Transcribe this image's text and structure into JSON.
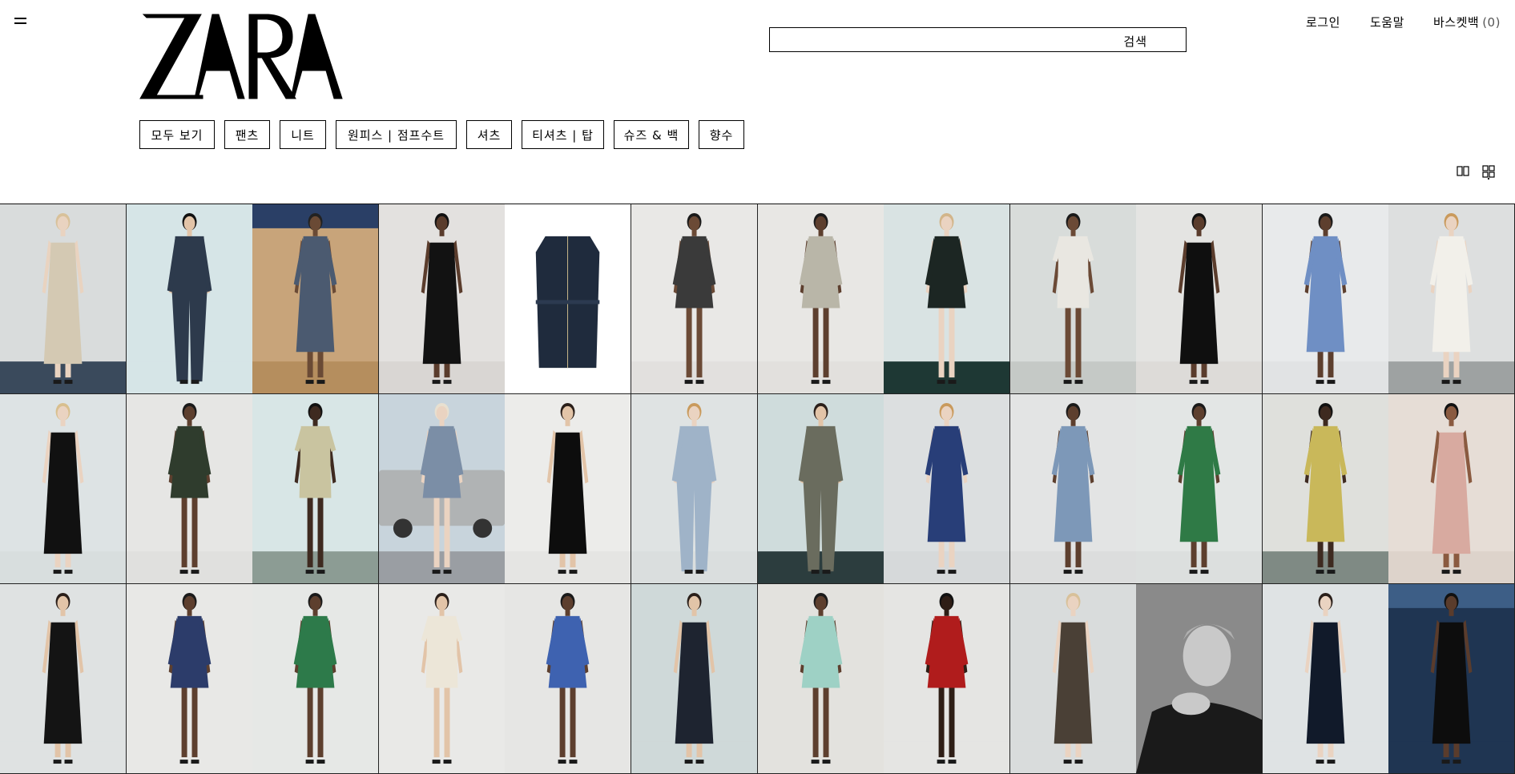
{
  "header": {
    "logo_text": "ZARA",
    "search_label": "검색",
    "links": {
      "login": "로그인",
      "help": "도움말",
      "basket": "바스켓백",
      "basket_count": "(0)"
    }
  },
  "categories": [
    "모두 보기",
    "팬츠",
    "니트",
    "원피스 | 점프수트",
    "셔츠",
    "티셔츠 | 탑",
    "슈즈 & 백",
    "향수"
  ],
  "icons": {
    "menu": "menu-icon",
    "two_column_view": "two-column-grid-icon",
    "four_column_view": "four-column-grid-icon"
  },
  "products": [
    {
      "bg": "#d9dcdc",
      "garment": "#d4c9b3",
      "skin": "#e9d3c0",
      "hair": "#d8c19a",
      "floor": "#3a4a5c",
      "type": "slip"
    },
    {
      "bg": "#d6e5e7",
      "garment": "#2d3a4c",
      "skin": "#e2c4a8",
      "hair": "#111",
      "floor": "#d6e5e7",
      "type": "jumpsuit"
    },
    {
      "bg": "#c8a47a",
      "garment": "#4b5a70",
      "skin": "#6a4a35",
      "hair": "#222",
      "floor": "#b58e5e",
      "type": "dress",
      "sky": "#2a3f66"
    },
    {
      "bg": "#e3e1df",
      "garment": "#121212",
      "skin": "#5a3c2c",
      "hair": "#111",
      "floor": "#d9d6d3",
      "type": "tube"
    },
    {
      "bg": "#ffffff",
      "garment": "#1f2b3d",
      "skin": "#ffffff",
      "hair": "#ffffff",
      "floor": "#ffffff",
      "type": "flat"
    },
    {
      "bg": "#e9e8e6",
      "garment": "#3a3a3a",
      "skin": "#6b4a36",
      "hair": "#1a1a1a",
      "floor": "#e2e0de",
      "type": "mini"
    },
    {
      "bg": "#e8e7e4",
      "garment": "#b9b6a8",
      "skin": "#5d3f2e",
      "hair": "#1a1a1a",
      "floor": "#e2e0dd",
      "type": "mini"
    },
    {
      "bg": "#d9e3e3",
      "garment": "#1c2623",
      "skin": "#ead3c1",
      "hair": "#d2b58a",
      "floor": "#1e3834",
      "type": "mini"
    },
    {
      "bg": "#d8dcda",
      "garment": "#e9e7e1",
      "skin": "#6b4a36",
      "hair": "#1a1a1a",
      "floor": "#c5c9c6",
      "type": "romper"
    },
    {
      "bg": "#e4e4e2",
      "garment": "#0f0f0f",
      "skin": "#5a3c2c",
      "hair": "#111",
      "floor": "#dddbd8",
      "type": "slip"
    },
    {
      "bg": "#e8eaeb",
      "garment": "#6f8fc4",
      "skin": "#5d3f2e",
      "hair": "#1a1a1a",
      "floor": "#e1e3e4",
      "type": "dress"
    },
    {
      "bg": "#dddfdf",
      "garment": "#f2f0ea",
      "skin": "#ead3c1",
      "hair": "#c99a5c",
      "floor": "#9ea2a2",
      "type": "dress"
    },
    {
      "bg": "#dde3e4",
      "garment": "#111111",
      "skin": "#ead3c1",
      "hair": "#d8bf8e",
      "floor": "#d8dede",
      "type": "tube"
    },
    {
      "bg": "#e6e6e4",
      "garment": "#2f3c2d",
      "skin": "#5d3f2e",
      "hair": "#1a1a1a",
      "floor": "#e0e0de",
      "type": "mini"
    },
    {
      "bg": "#d8e6e6",
      "garment": "#c9c4a0",
      "skin": "#3e2a20",
      "hair": "#111",
      "floor": "#8c9c94",
      "type": "romper"
    },
    {
      "bg": "#c8d4dc",
      "garment": "#7b8ea6",
      "skin": "#ead3c1",
      "hair": "#e8e0d0",
      "floor": "#9a9ea3",
      "type": "mini",
      "truck": "#b0b3b4"
    },
    {
      "bg": "#ececea",
      "garment": "#0d0d0d",
      "skin": "#e2c4a8",
      "hair": "#2a1f1a",
      "floor": "#e5e5e3",
      "type": "slip"
    },
    {
      "bg": "#dfe3e3",
      "garment": "#9fb3c8",
      "skin": "#ead3c1",
      "hair": "#c99a5c",
      "floor": "#dadede",
      "type": "jumpsuit"
    },
    {
      "bg": "#cfdcdc",
      "garment": "#6a6c5e",
      "skin": "#e2c4a8",
      "hair": "#2a1f1a",
      "floor": "#2c3d3e",
      "type": "jumpsuit"
    },
    {
      "bg": "#dcdfe0",
      "garment": "#283e78",
      "skin": "#ead3c1",
      "hair": "#c99a5c",
      "floor": "#d6d9da",
      "type": "dress"
    },
    {
      "bg": "#e3e4e4",
      "garment": "#7d98b8",
      "skin": "#5d3f2e",
      "hair": "#1a1a1a",
      "floor": "#dcdddd",
      "type": "dress"
    },
    {
      "bg": "#e3e6e5",
      "garment": "#2f7a46",
      "skin": "#5d3f2e",
      "hair": "#1a1a1a",
      "floor": "#dcdfde",
      "type": "dress"
    },
    {
      "bg": "#dfe0dc",
      "garment": "#c9b85a",
      "skin": "#3e2a20",
      "hair": "#111",
      "floor": "#7f8a84",
      "type": "dress"
    },
    {
      "bg": "#e6ddd6",
      "garment": "#d8aaa0",
      "skin": "#8a5a40",
      "hair": "#111",
      "floor": "#ddd3cb",
      "type": "slip"
    },
    {
      "bg": "#dfe2e2",
      "garment": "#141414",
      "skin": "#e2c4a8",
      "hair": "#2a1f1a",
      "floor": "#dfe2e2",
      "type": "slip"
    },
    {
      "bg": "#e8e8e6",
      "garment": "#2c3c6a",
      "skin": "#5d3f2e",
      "hair": "#1a1a1a",
      "floor": "#e8e8e6",
      "type": "mini"
    },
    {
      "bg": "#e6e8e6",
      "garment": "#2d7a4a",
      "skin": "#5d3f2e",
      "hair": "#1a1a1a",
      "floor": "#e6e8e6",
      "type": "mini"
    },
    {
      "bg": "#e9e9e7",
      "garment": "#ece6d8",
      "skin": "#e2c4a8",
      "hair": "#2a1f1a",
      "floor": "#e9e9e7",
      "type": "romper"
    },
    {
      "bg": "#e6e6e4",
      "garment": "#3e62b0",
      "skin": "#5d3f2e",
      "hair": "#1a1a1a",
      "floor": "#e6e6e4",
      "type": "mini"
    },
    {
      "bg": "#cfd9d9",
      "garment": "#1e2430",
      "skin": "#e2c4a8",
      "hair": "#2a1f1a",
      "floor": "#cfd9d9",
      "type": "tube"
    },
    {
      "bg": "#e3e2de",
      "garment": "#9ed1c5",
      "skin": "#5d3f2e",
      "hair": "#1a1a1a",
      "floor": "#e3e2de",
      "type": "mini"
    },
    {
      "bg": "#e5e5e3",
      "garment": "#b01c1c",
      "skin": "#2e1e16",
      "hair": "#111",
      "floor": "#e5e5e3",
      "type": "mini"
    },
    {
      "bg": "#d9dcdc",
      "garment": "#4a4036",
      "skin": "#ead3c1",
      "hair": "#d8c19a",
      "floor": "#d9dcdc",
      "type": "slip"
    },
    {
      "bg": "#8a8a8a",
      "garment": "#1a1a1a",
      "skin": "#c9c9c9",
      "hair": "#b0b0b0",
      "floor": "#8a8a8a",
      "type": "portrait"
    },
    {
      "bg": "#dfe3e4",
      "garment": "#111a2a",
      "skin": "#ead3c1",
      "hair": "#2a1f1a",
      "floor": "#dfe3e4",
      "type": "tube"
    },
    {
      "bg": "#1f3552",
      "garment": "#0d0d0d",
      "skin": "#5a3c2c",
      "hair": "#111",
      "floor": "#1f3552",
      "type": "tube",
      "sky": "#3d5e86"
    }
  ]
}
